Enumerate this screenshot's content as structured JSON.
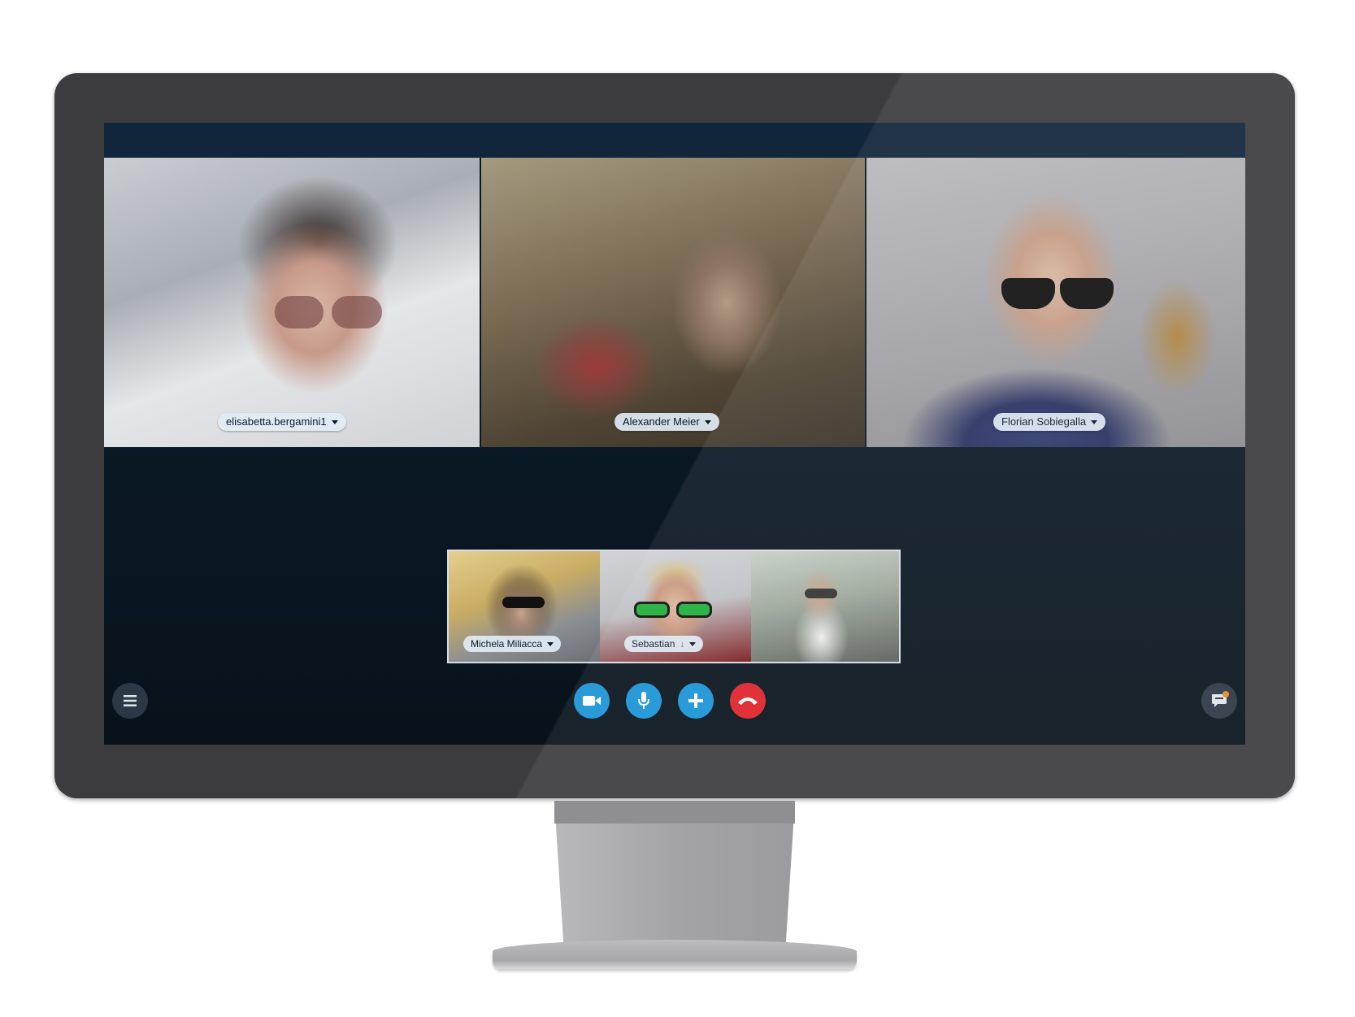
{
  "call": {
    "participants": [
      {
        "name": "elisabetta.bergamini1"
      },
      {
        "name": "Alexander Meier"
      },
      {
        "name": "Florian Sobiegalla"
      }
    ],
    "self_view": [
      {
        "name": "Michela Miliacca"
      },
      {
        "name": "Sebastian"
      },
      {
        "name": ""
      }
    ]
  },
  "controls": {
    "video_icon": "video-camera-icon",
    "mic_icon": "microphone-icon",
    "add_icon": "plus-icon",
    "end_icon": "hang-up-icon",
    "menu_icon": "menu-icon",
    "chat_icon": "chat-icon",
    "colors": {
      "accent": "#1a93d6",
      "end_call": "#e0222a",
      "notification": "#f08a24"
    }
  }
}
